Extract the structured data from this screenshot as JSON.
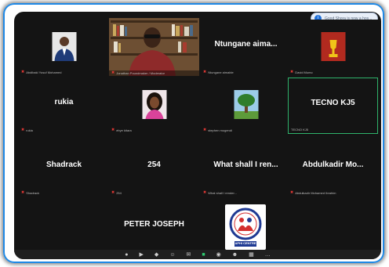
{
  "notification": {
    "text": "Good Shora is now a hos..."
  },
  "participants": [
    {
      "name": "",
      "label": "Abdibaki Yusuf Mohamed"
    },
    {
      "name": "",
      "label": "Jonathan Poundmaker / Moderator"
    },
    {
      "name": "Ntungane aima...",
      "label": "Ntungane aimable"
    },
    {
      "name": "",
      "label": "David Mumo"
    },
    {
      "name": "rukia",
      "label": "rukia"
    },
    {
      "name": "",
      "label": "ebye kitara"
    },
    {
      "name": "",
      "label": "stephen mugendi"
    },
    {
      "name": "TECNO KJ5",
      "label": "TECNO KJ5"
    },
    {
      "name": "Shadrack",
      "label": "Shadrack"
    },
    {
      "name": "254",
      "label": "254"
    },
    {
      "name": "What shall I ren...",
      "label": "What shall I render..."
    },
    {
      "name": "Abdulkadir Mo...",
      "label": "Abdulkadir Mohamed Ibrahim"
    },
    {
      "name": "PETER JOSEPH",
      "label": "PETER JOSEPH"
    },
    {
      "name": "",
      "label": "APHI CENTRE"
    }
  ],
  "logo": {
    "text": "APHI CENTRE"
  },
  "toolbar": {
    "icons": [
      "mic-icon",
      "video-icon",
      "security-icon",
      "participants-icon",
      "chat-icon",
      "share-screen-icon",
      "record-icon",
      "reactions-icon",
      "apps-icon",
      "more-icon"
    ]
  },
  "colors": {
    "background": "#141414",
    "active_speaker": "#2fb36b",
    "mic_muted": "#e53935"
  }
}
